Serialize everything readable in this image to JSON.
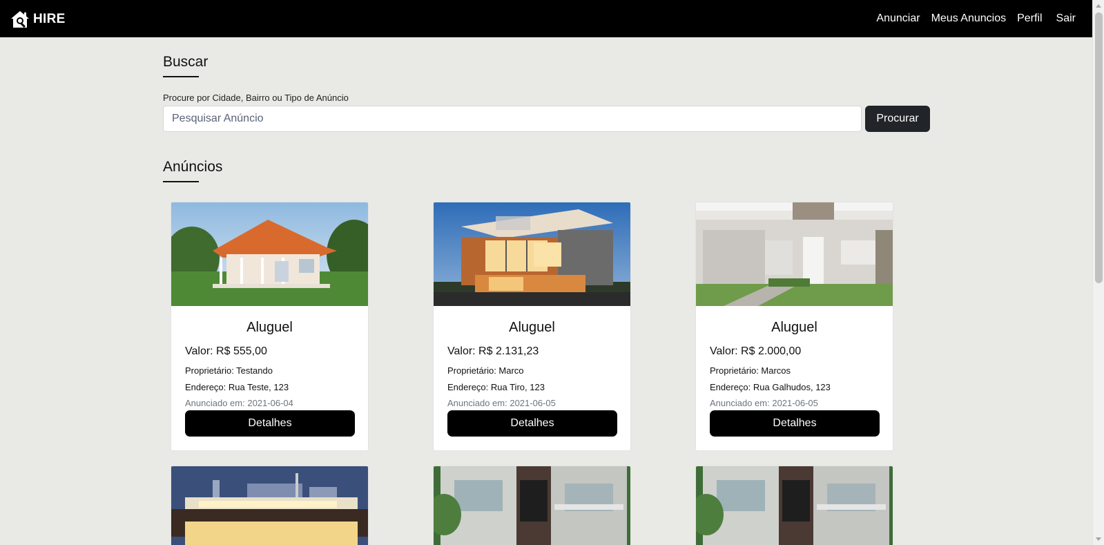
{
  "navbar": {
    "brand": "HIRE",
    "links": [
      "Anunciar",
      "Meus Anuncios",
      "Perfil",
      "Sair"
    ]
  },
  "search": {
    "heading": "Buscar",
    "label": "Procure por Cidade, Bairro ou Tipo de Anúncio",
    "placeholder": "Pesquisar Anúncio",
    "button": "Procurar"
  },
  "listings": {
    "heading": "Anúncios",
    "cards": [
      {
        "type": "Aluguel",
        "price": "Valor: R$ 555,00",
        "owner": "Proprietário: Testando",
        "address": "Endereço: Rua Teste, 123",
        "date": "Anunciado em: 2021-06-04",
        "button": "Detalhes",
        "image": "house-with-veranda"
      },
      {
        "type": "Aluguel",
        "price": "Valor: R$ 2.131,23",
        "owner": "Proprietário: Marco",
        "address": "Endereço: Rua Tiro, 123",
        "date": "Anunciado em: 2021-06-05",
        "button": "Detalhes",
        "image": "modern-house-dusk"
      },
      {
        "type": "Aluguel",
        "price": "Valor: R$ 2.000,00",
        "owner": "Proprietário: Marcos",
        "address": "Endereço: Rua Galhudos, 123",
        "date": "Anunciado em: 2021-06-05",
        "button": "Detalhes",
        "image": "white-house-garage"
      }
    ],
    "partial_cards": [
      "flat-roof-house-night",
      "two-story-modern-house",
      "two-story-modern-house"
    ]
  },
  "colors": {
    "navbar_bg": "#000000",
    "page_bg": "#e9e9e6",
    "search_button": "#212529",
    "details_button": "#000000",
    "date_text": "#6c757d"
  }
}
